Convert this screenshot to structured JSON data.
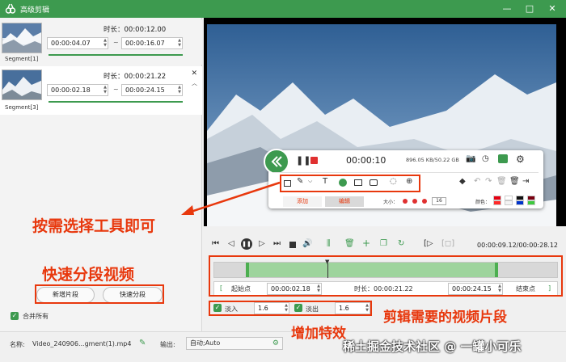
{
  "title_bar": {
    "title": "高级剪辑",
    "minimize": "—",
    "restore": "□",
    "close": "✕"
  },
  "segments": [
    {
      "label": "Segment[1]",
      "duration": "时长：00:00:12.00",
      "start": "00:00:04.07",
      "end": "00:00:16.07"
    },
    {
      "label": "Segment[3]",
      "duration": "时长：00:00:21.22",
      "start": "00:00:02.18",
      "end": "00:00:24.15"
    }
  ],
  "left_actions": {
    "add_segment": "新增片段",
    "quick_split": "快速分段",
    "merge_all": "合并所有"
  },
  "floating_toolbar": {
    "time": "00:00:10",
    "stats": "896.05 KB/50.22 GB",
    "tab_add": "添加",
    "tab_edit": "编辑",
    "size_label": "大小：",
    "size_value": "16",
    "color_label": "颜色：",
    "palette": [
      "#e60012",
      "#ffffff",
      "#111111",
      "#7a0010",
      "#ff2a2a",
      "#f4f4f4",
      "#0033cc",
      "#3ec93e"
    ]
  },
  "timeline": {
    "current_time": "00:00:09.12/00:00:28.12",
    "start_point": "起始点",
    "start_time": "00:00:02.18",
    "duration": "时长：00:00:21.22",
    "end_time": "00:00:24.15",
    "end_point": "结束点",
    "fade_in_label": "淡入",
    "fade_in": "1.6",
    "fade_out_label": "淡出",
    "fade_out": "1.6"
  },
  "bottom_bar": {
    "name_label": "名称:",
    "name_value": "Video_240906...gment(1).mp4",
    "output_label": "输出:",
    "output_value": "自动;Auto"
  },
  "annotations": {
    "select_tool": "按需选择工具即可",
    "quick_split": "快速分段视频",
    "clip_segment": "剪辑需要的视频片段",
    "add_effects": "增加特效",
    "watermark": "稀土掘金技术社区 @ 一罐小可乐"
  },
  "colors": {
    "accent": "#3d9a4f",
    "annotation": "#e8380d"
  }
}
